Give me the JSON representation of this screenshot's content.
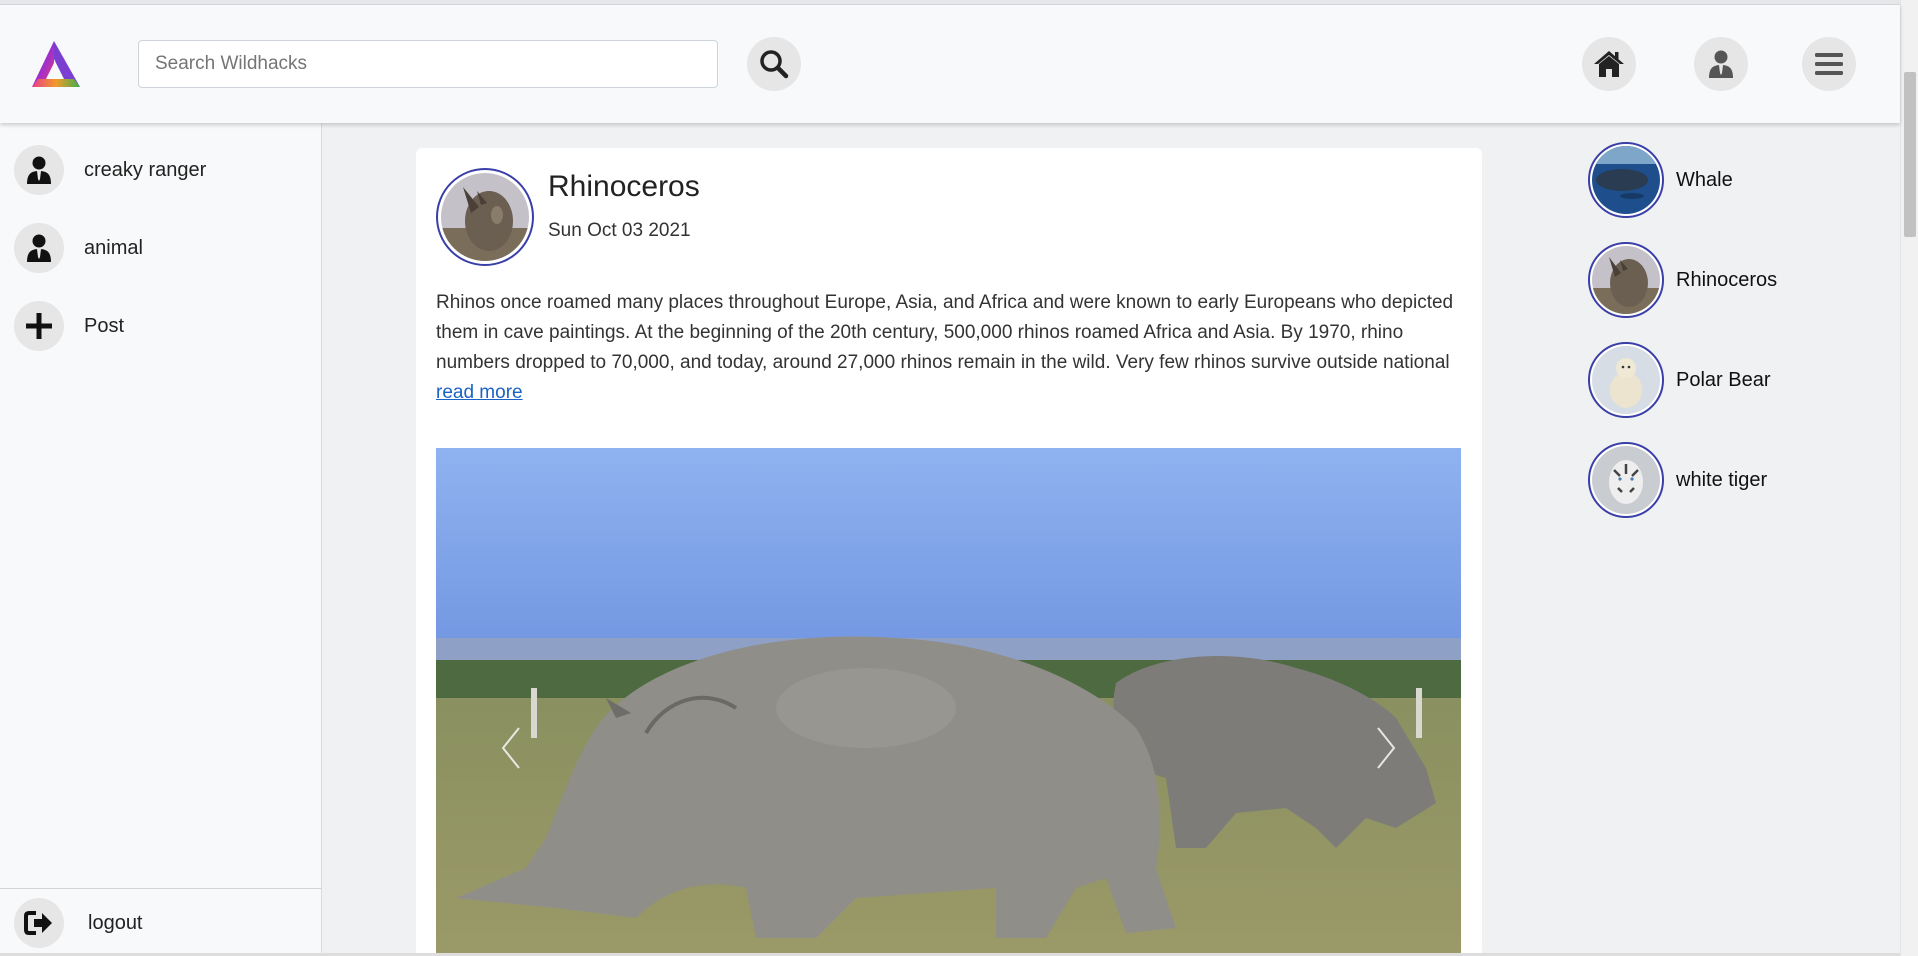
{
  "header": {
    "search_placeholder": "Search Wildhacks"
  },
  "sidebar": {
    "items": [
      {
        "label": "creaky ranger",
        "icon": "user-icon"
      },
      {
        "label": "animal",
        "icon": "user-icon"
      },
      {
        "label": "Post",
        "icon": "plus-icon"
      }
    ],
    "logout_label": "logout"
  },
  "post": {
    "title": "Rhinoceros",
    "date": "Sun Oct 03 2021",
    "text": "Rhinos once roamed many places throughout Europe, Asia, and Africa and were known to early Europeans who depicted them in cave paintings. At the beginning of the 20th century, 500,000 rhinos roamed Africa and Asia. By 1970, rhino numbers dropped to 70,000, and today, around 27,000 rhinos remain in the wild. Very few rhinos survive outside national",
    "read_more": "read more"
  },
  "animals": [
    {
      "label": "Whale"
    },
    {
      "label": "Rhinoceros"
    },
    {
      "label": "Polar Bear"
    },
    {
      "label": "white tiger"
    }
  ],
  "colors": {
    "accent_border": "#3a3fa8",
    "link": "#1a62c4",
    "header_bg": "#f8f9fa",
    "page_bg": "#f0f1f3"
  }
}
